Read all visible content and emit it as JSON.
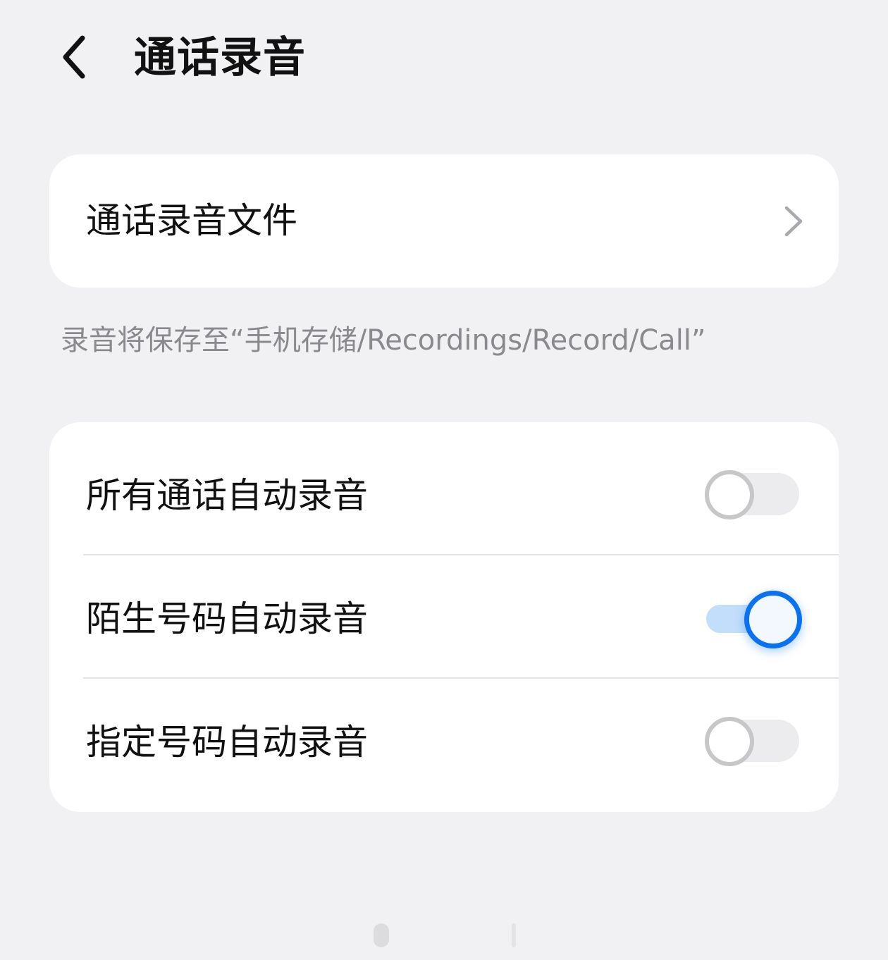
{
  "header": {
    "back_icon": "chevron-left-icon",
    "title": "通话录音"
  },
  "files_card": {
    "label": "通话录音文件",
    "chevron_icon": "chevron-right-icon"
  },
  "hint": "录音将保存至“手机存储/Recordings/Record/Call”",
  "settings": [
    {
      "label": "所有通话自动录音",
      "enabled": false
    },
    {
      "label": "陌生号码自动录音",
      "enabled": true
    },
    {
      "label": "指定号码自动录音",
      "enabled": false
    }
  ],
  "colors": {
    "background": "#f1f1f3",
    "card": "#ffffff",
    "accent": "#0a72f0",
    "accent_track": "#c3defb",
    "off_thumb_border": "#c7c7c9",
    "off_track": "#ececee",
    "hint_text": "#8a8a8e"
  }
}
